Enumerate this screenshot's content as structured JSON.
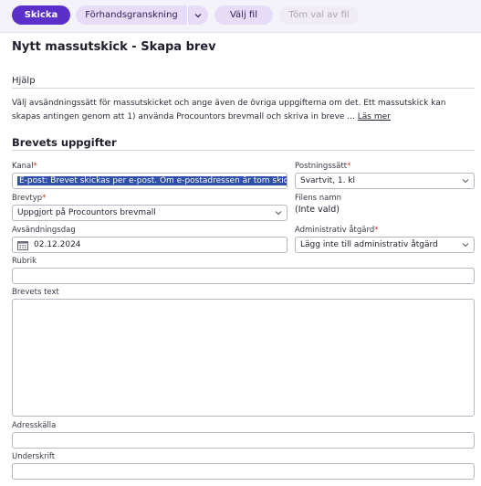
{
  "toolbar": {
    "send_label": "Skicka",
    "preview_label": "Förhandsgranskning",
    "choose_file_label": "Välj fil",
    "clear_file_label": "Töm val av fil"
  },
  "page": {
    "title": "Nytt massutskick - Skapa brev"
  },
  "help": {
    "heading": "Hjälp",
    "text": "Välj avsändningssätt för massutskicket och ange även de övriga uppgifterna om det. Ett massutskick kan skapas antingen genom att 1) använda Procountors brevmall och skriva in breve ...",
    "read_more": "Läs mer"
  },
  "details": {
    "heading": "Brevets uppgifter",
    "kanal_label": "Kanal",
    "kanal_value": "E-post: Brevet skickas per e-post. Om e-postadressen är tom skic",
    "postning_label": "Postningssätt",
    "postning_value": "Svartvit, 1. kl",
    "brevtyp_label": "Brevtyp",
    "brevtyp_value": "Uppgjort på Procountors brevmall",
    "filnamn_label": "Filens namn",
    "filnamn_value": "(Inte vald)",
    "avsandning_label": "Avsändningsdag",
    "avsandning_value": "02.12.2024",
    "admin_label": "Administrativ åtgärd",
    "admin_value": "Lägg inte till administrativ åtgärd",
    "rubrik_label": "Rubrik",
    "rubrik_value": "",
    "brevtext_label": "Brevets text",
    "brevtext_value": "",
    "adresskalla_label": "Adresskälla",
    "adresskalla_value": "",
    "underskrift_label": "Underskrift",
    "underskrift_value": "",
    "required_mark": "*"
  },
  "colors": {
    "primary": "#5b2fc9",
    "secondary_bg": "#e6dcf7",
    "selection": "#2f4fa8",
    "required": "#c0392b"
  },
  "icons": {
    "caret": "chevron-down-icon",
    "calendar": "calendar-icon"
  }
}
